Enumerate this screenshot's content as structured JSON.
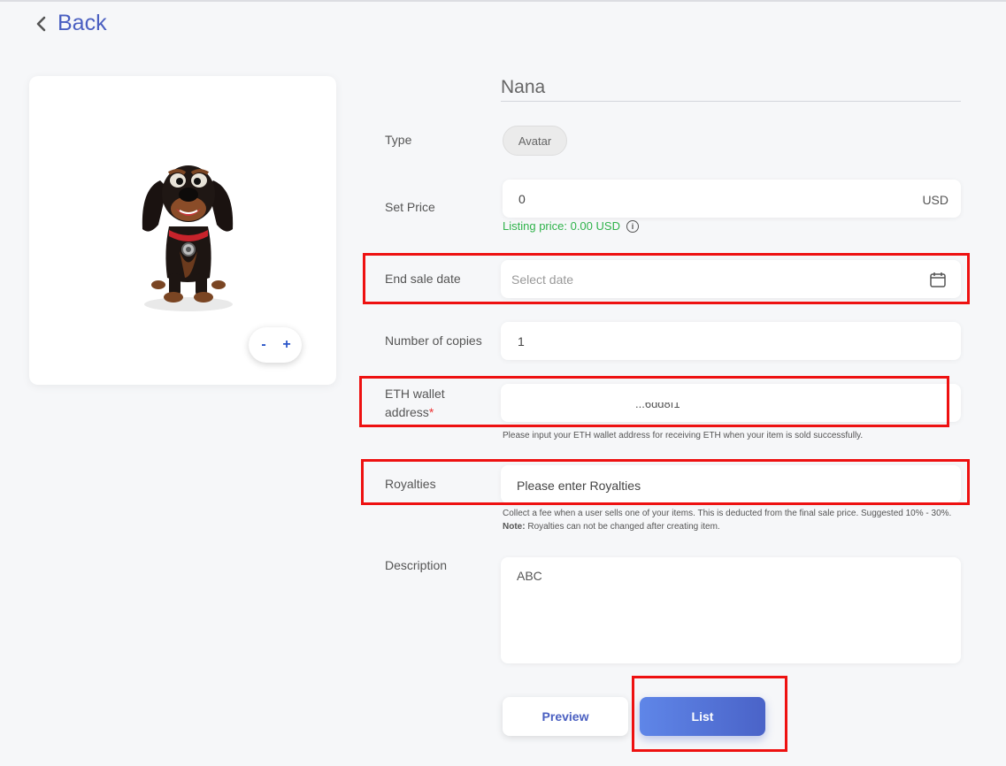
{
  "nav": {
    "back_label": "Back"
  },
  "preview": {
    "zoom_out": "-",
    "zoom_in": "+"
  },
  "item": {
    "name": "Nana"
  },
  "form": {
    "type": {
      "label": "Type",
      "value": "Avatar"
    },
    "price": {
      "label": "Set Price",
      "value": "0",
      "unit": "USD",
      "listing_price": "Listing price: 0.00 USD"
    },
    "end_date": {
      "label": "End sale date",
      "placeholder": "Select date"
    },
    "copies": {
      "label": "Number of copies",
      "value": "1"
    },
    "wallet": {
      "label_line1": "ETH wallet",
      "label_line2": "address",
      "required_mark": "*",
      "value_partial": "...6dd8f1",
      "hint": "Please input your ETH wallet address for receiving ETH when your item is sold successfully."
    },
    "royalties": {
      "label": "Royalties",
      "placeholder": "Please enter Royalties",
      "hint": "Collect a fee when a user sells one of your items. This is deducted from the final sale price. Suggested 10% - 30%.",
      "note_label": "Note:",
      "note_text": " Royalties can not be changed after creating item."
    },
    "description": {
      "label": "Description",
      "value": "ABC"
    }
  },
  "actions": {
    "preview_label": "Preview",
    "list_label": "List"
  },
  "colors": {
    "accent": "#4a5fc1",
    "success": "#2fb24a",
    "highlight": "#ee1111"
  },
  "icons": {
    "back": "chevron-left-icon",
    "info": "info-icon",
    "calendar": "calendar-icon"
  }
}
